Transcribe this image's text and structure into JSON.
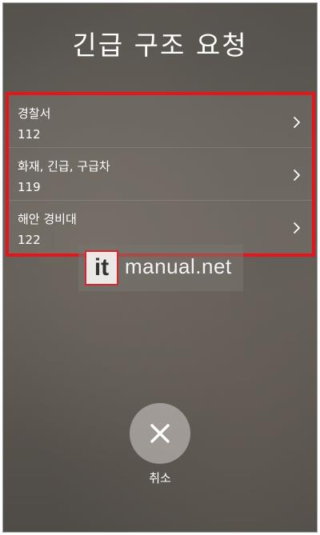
{
  "screen": {
    "title": "긴급 구조 요청"
  },
  "contacts": [
    {
      "label": "경찰서",
      "number": "112"
    },
    {
      "label": "화재, 긴급, 구급차",
      "number": "119"
    },
    {
      "label": "해안 경비대",
      "number": "122"
    }
  ],
  "watermark": {
    "badge": "it",
    "text": "manual.net"
  },
  "cancel": {
    "label": "취소"
  },
  "colors": {
    "highlight_border": "#e8141b",
    "text": "#ffffff"
  }
}
